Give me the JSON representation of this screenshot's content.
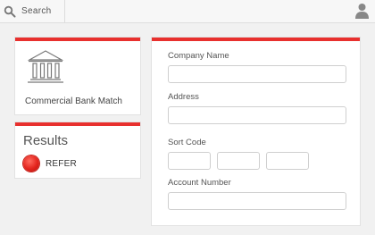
{
  "search": {
    "label": "Search",
    "icon": "search-icon"
  },
  "header": {
    "user_icon": "user-icon"
  },
  "bank_card": {
    "label": "Commercial Bank Match",
    "icon": "bank-icon"
  },
  "results": {
    "title": "Results",
    "status": "REFER",
    "status_color": "#e3241d"
  },
  "form": {
    "company_name_label": "Company Name",
    "company_name_value": "",
    "address_label": "Address",
    "address_value": "",
    "sort_code_label": "Sort Code",
    "sort_code_parts": [
      "",
      "",
      ""
    ],
    "account_number_label": "Account Number",
    "account_number_value": ""
  },
  "colors": {
    "accent": "#e8302e",
    "background": "#f1f1f1"
  }
}
